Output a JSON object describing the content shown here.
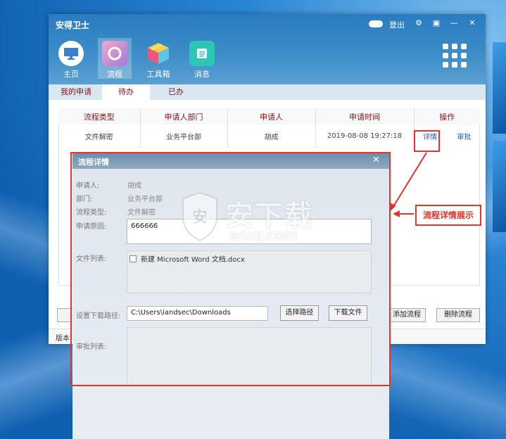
{
  "window": {
    "app_title": "安得卫士",
    "logout_label": "登出",
    "controls": [
      "⚙",
      "▣",
      "—",
      "✕"
    ]
  },
  "nav": {
    "items": [
      {
        "label": "主页",
        "icon": "monitor-icon"
      },
      {
        "label": "流程",
        "icon": "process-icon",
        "active": true
      },
      {
        "label": "工具箱",
        "icon": "cube-icon"
      },
      {
        "label": "消息",
        "icon": "message-icon"
      }
    ]
  },
  "tabs": [
    {
      "label": "我的申请"
    },
    {
      "label": "待办",
      "active": true
    },
    {
      "label": "已办"
    }
  ],
  "table": {
    "headers": [
      "流程类型",
      "申请人部门",
      "申请人",
      "申请时间",
      "操作"
    ],
    "rows": [
      {
        "type": "文件解密",
        "dept": "业务平台部",
        "applicant": "胡成",
        "time": "2019-08-08 19:27:18",
        "detail": "详情",
        "approve": "审批"
      }
    ]
  },
  "app_buttons": {
    "add": "添加流程",
    "delete": "删除流程"
  },
  "status": {
    "version_prefix": "版本"
  },
  "dialog": {
    "title": "流程详情",
    "close": "✕",
    "applicant_label": "申请人:",
    "applicant_value": "胡成",
    "dept_label": "部门:",
    "dept_value": "业务平台部",
    "type_label": "流程类型:",
    "type_value": "文件解密",
    "reason_label": "申请原因:",
    "reason_value": "666666",
    "files_label": "文件列表:",
    "file_item": "新建 Microsoft Word 文档.docx",
    "path_label": "设置下载路径:",
    "path_value": "C:\\Users\\iandsec\\Downloads",
    "choose_path": "选择路径",
    "download": "下载文件",
    "approval_label": "审批列表:"
  },
  "annotation": {
    "callout": "流程详情展示"
  },
  "watermark": {
    "text": "安下载",
    "sub": "anxz.com"
  },
  "colors": {
    "annotation_red": "#e6342a",
    "header_blue": "#2a7cc0",
    "tab_text": "#8b1010",
    "link_blue": "#1a5fd0"
  }
}
